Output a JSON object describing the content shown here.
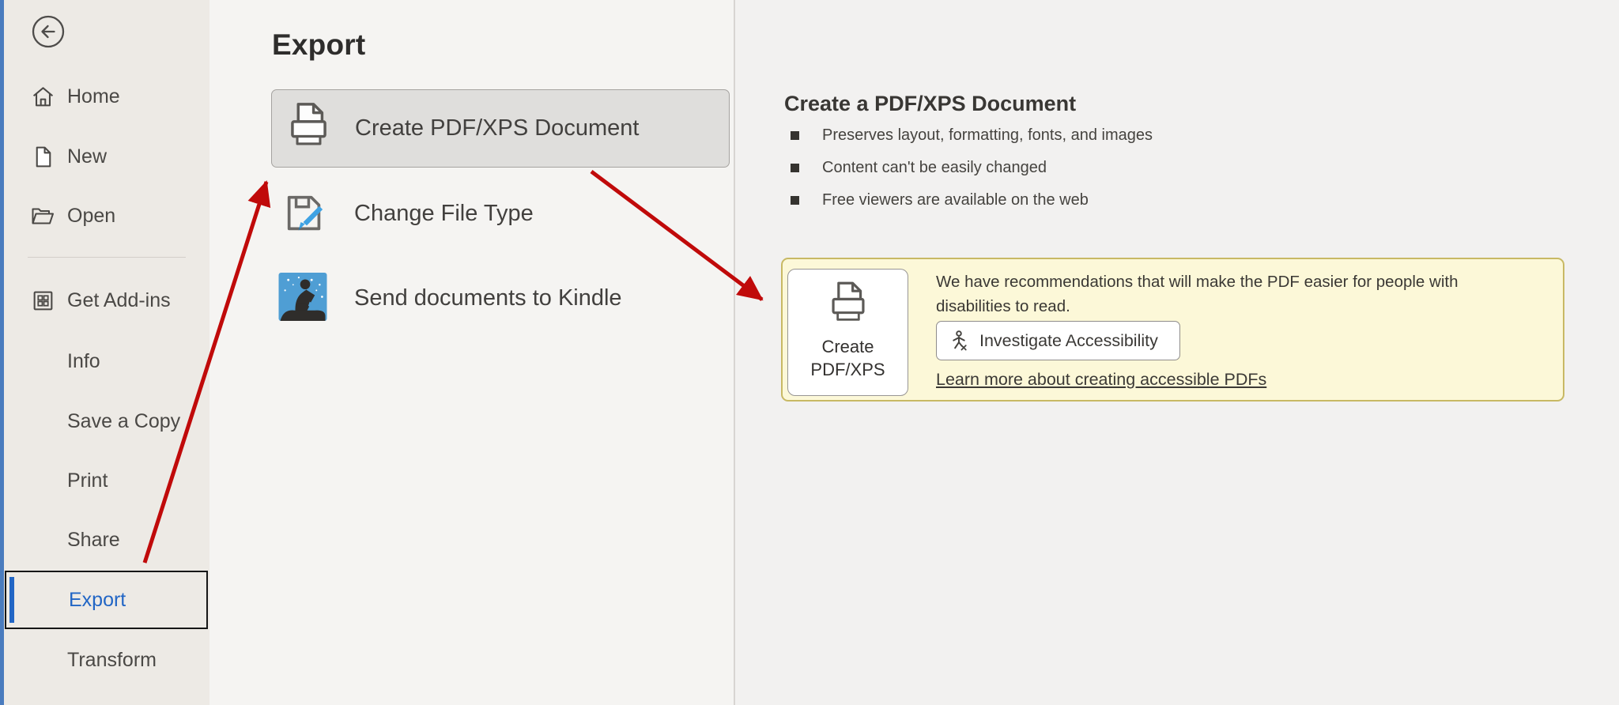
{
  "sidebar": {
    "items": [
      {
        "label": "Home",
        "icon": "home-icon"
      },
      {
        "label": "New",
        "icon": "new-document-icon"
      },
      {
        "label": "Open",
        "icon": "open-folder-icon"
      },
      {
        "label": "Get Add-ins",
        "icon": "add-ins-icon"
      },
      {
        "label": "Info",
        "icon": ""
      },
      {
        "label": "Save a Copy",
        "icon": ""
      },
      {
        "label": "Print",
        "icon": ""
      },
      {
        "label": "Share",
        "icon": ""
      },
      {
        "label": "Export",
        "icon": "",
        "selected": true
      },
      {
        "label": "Transform",
        "icon": ""
      }
    ]
  },
  "main": {
    "title": "Export",
    "options": [
      {
        "label": "Create PDF/XPS Document",
        "icon": "create-pdf-xps-icon",
        "selected": true
      },
      {
        "label": "Change File Type",
        "icon": "change-file-type-icon"
      },
      {
        "label": "Send documents to Kindle",
        "icon": "kindle-icon"
      }
    ]
  },
  "detail": {
    "heading": "Create a PDF/XPS Document",
    "bullets": [
      "Preserves layout, formatting, fonts, and images",
      "Content can't be easily changed",
      "Free viewers are available on the web"
    ],
    "recommendation": {
      "message_lines": [
        "We have recommendations that will make the PDF easier for people with",
        "disabilities to read."
      ],
      "create_button_lines": [
        "Create",
        "PDF/XPS"
      ],
      "investigate_button_label": "Investigate Accessibility",
      "learn_more_label": "Learn more about creating accessible PDFs"
    }
  },
  "colors": {
    "accent_blue": "#2266C5",
    "annotation_red": "#C00A0A",
    "note_bg": "#FCF8D8",
    "note_border": "#C8B964",
    "kindle_blue": "#4F9ED4",
    "pencil_blue": "#3FA2E3",
    "sidebar_bg": "#EDEAE5",
    "selected_option_bg": "#DFDEDC"
  }
}
